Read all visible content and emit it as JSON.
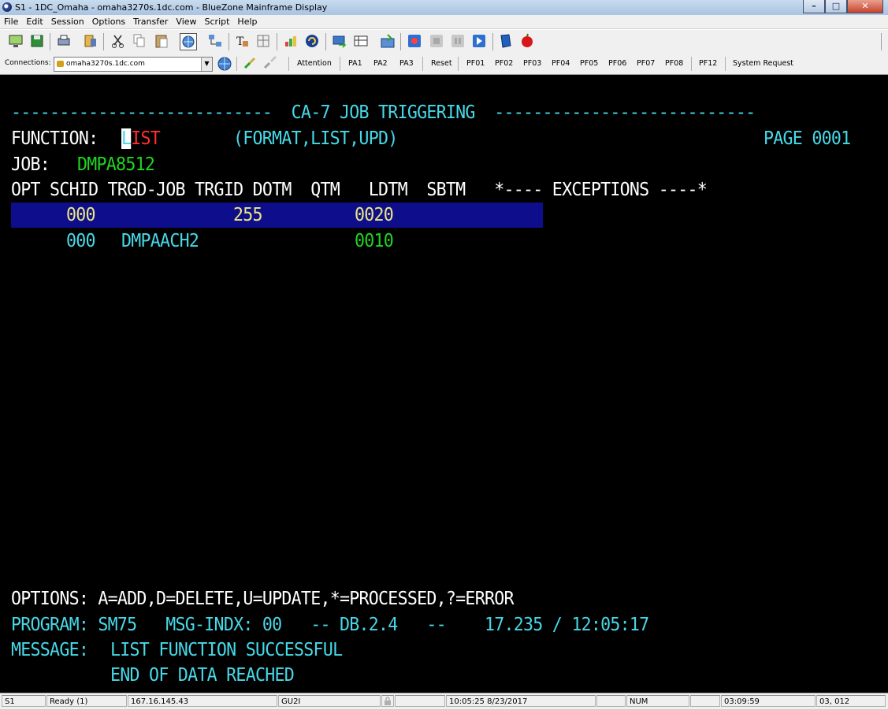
{
  "window": {
    "title": "S1 - 1DC_Omaha - omaha3270s.1dc.com - BlueZone Mainframe Display",
    "minimize": "–",
    "maximize": "□",
    "close": "✕"
  },
  "menu": [
    "File",
    "Edit",
    "Session",
    "Options",
    "Transfer",
    "View",
    "Script",
    "Help"
  ],
  "connections": {
    "label": "Connections:",
    "selected": "omaha3270s.1dc.com"
  },
  "keys": [
    "Attention",
    "PA1",
    "PA2",
    "PA3",
    "Reset",
    "PF01",
    "PF02",
    "PF03",
    "PF04",
    "PF05",
    "PF06",
    "PF07",
    "PF08",
    "PF12",
    "System Request"
  ],
  "terminal": {
    "title_line": "---------------------------  CA-7 JOB TRIGGERING  ---------------------------",
    "function_label": "FUNCTION:",
    "function_cursor": "L",
    "function_rest": "IST",
    "function_options": "(FORMAT,LIST,UPD)",
    "page": "PAGE 0001",
    "job_label": "JOB:",
    "job_value": "DMPA8512",
    "header": "OPT SCHID TRGD-JOB TRGID DOTM  QTM   LDTM  SBTM   *---- EXCEPTIONS ----*",
    "rows": [
      {
        "schid": "000",
        "trgd_job": "",
        "trgid": "255",
        "qtm": "0020"
      },
      {
        "schid": "000",
        "trgd_job": "DMPAACH2",
        "trgid": "",
        "qtm": "0010"
      }
    ],
    "options_line": "OPTIONS: A=ADD,D=DELETE,U=UPDATE,*=PROCESSED,?=ERROR",
    "program_line": "PROGRAM: SM75   MSG-INDX: 00   -- DB.2.4   --    17.235 / 12:05:17",
    "message_label": "MESSAGE:",
    "message_1": "LIST FUNCTION SUCCESSFUL",
    "message_2": "END OF DATA REACHED"
  },
  "status": {
    "session": "S1",
    "state": "Ready (1)",
    "ip": "167.16.145.43",
    "lu": "GU2I",
    "datetime": "10:05:25  8/23/2017",
    "num": "NUM",
    "elapsed": "03:09:59",
    "cursor_pos": "03, 012"
  }
}
